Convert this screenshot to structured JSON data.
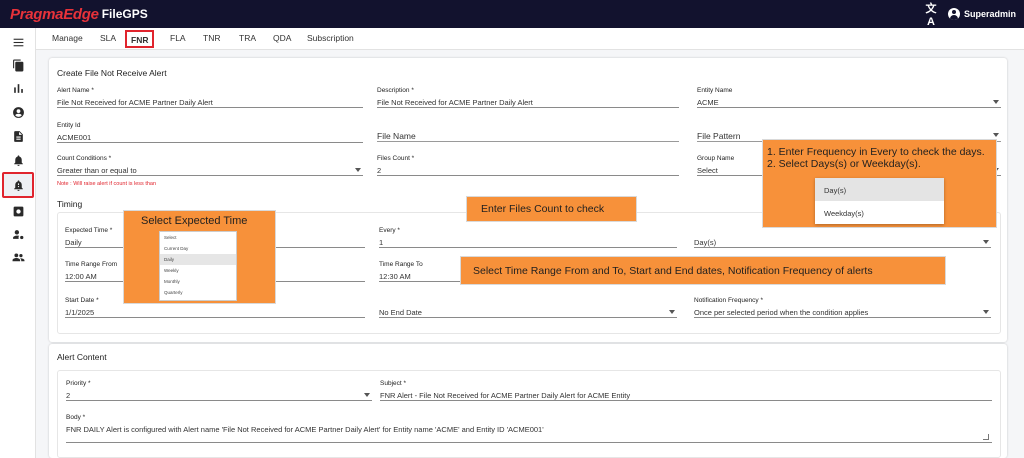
{
  "header": {
    "brand": "PragmaEdge",
    "product": "FileGPS",
    "translate_glyph": "文A",
    "user": "Superadmin"
  },
  "sidebar": {
    "items": [
      {
        "icon": "menu-icon"
      },
      {
        "icon": "files-icon"
      },
      {
        "icon": "bar-chart-icon"
      },
      {
        "icon": "account-icon"
      },
      {
        "icon": "document-icon"
      },
      {
        "icon": "bell-alert-icon"
      },
      {
        "icon": "bell-alert-active-icon",
        "active": true
      },
      {
        "icon": "settings-box-icon"
      },
      {
        "icon": "user-settings-icon"
      },
      {
        "icon": "group-icon"
      }
    ]
  },
  "tabs": [
    "Manage",
    "SLA",
    "FNR",
    "FLA",
    "TNR",
    "TRA",
    "QDA",
    "Subscription"
  ],
  "active_tab": "FNR",
  "form": {
    "title": "Create File Not Receive Alert",
    "alert_name": {
      "label": "Alert Name *",
      "value": "File Not Received for ACME Partner Daily Alert"
    },
    "description": {
      "label": "Description *",
      "value": "File Not Received for ACME Partner Daily Alert"
    },
    "entity_name": {
      "label": "Entity Name",
      "value": "ACME"
    },
    "entity_id": {
      "label": "Entity Id",
      "value": "ACME001"
    },
    "file_name": {
      "label": "File Name",
      "value": ""
    },
    "file_pattern": {
      "label": "File Pattern",
      "value": ""
    },
    "count_conditions": {
      "label": "Count Conditions *",
      "value": "Greater than or equal to"
    },
    "note": "Note : Will raise alert if count is less than",
    "files_count": {
      "label": "Files Count *",
      "value": "2"
    },
    "group_name": {
      "label": "Group Name",
      "value": "Select"
    }
  },
  "timing": {
    "title": "Timing",
    "expected_time": {
      "label": "Expected Time *",
      "value": "Daily"
    },
    "every": {
      "label": "Every *",
      "value": "1"
    },
    "every_unit": {
      "value": "Day(s)"
    },
    "time_range_from": {
      "label": "Time Range From",
      "value": "12:00 AM"
    },
    "time_range_to": {
      "label": "Time Range To",
      "value": "12:30 AM"
    },
    "start_date": {
      "label": "Start Date *",
      "value": "1/1/2025"
    },
    "end_date": {
      "value": "No End Date"
    },
    "notification_frequency": {
      "label": "Notification Frequency *",
      "value": "Once per selected period when the condition applies"
    }
  },
  "content": {
    "title": "Alert Content",
    "priority": {
      "label": "Priority *",
      "value": "2"
    },
    "subject": {
      "label": "Subject *",
      "value": "FNR Alert - File Not Received for ACME Partner Daily Alert for ACME Entity"
    },
    "body": {
      "label": "Body *",
      "value": "FNR DAILY Alert is configured with Alert name 'File Not Received for ACME Partner Daily Alert' for Entity name 'ACME' and Entity ID 'ACME001'"
    }
  },
  "callouts": {
    "expected_time": {
      "text": "Select Expected Time",
      "options": [
        "Select",
        "Current Day",
        "Daily",
        "Weekly",
        "Monthly",
        "Quarterly"
      ],
      "highlighted": "Daily"
    },
    "files_count": "Enter Files Count to check",
    "time_range": "Select Time Range From and To, Start and End dates, Notification Frequency of alerts",
    "frequency": {
      "line1": "1. Enter Frequency in Every to check the days.",
      "line2": "2. Select Days(s) or Weekday(s).",
      "options": [
        "Day(s)",
        "Weekday(s)"
      ],
      "highlighted": "Day(s)"
    }
  },
  "colors": {
    "topbar": "#12122e",
    "brand": "#e8323a",
    "highlight_border": "#e0242d",
    "callout": "#f7913a"
  }
}
